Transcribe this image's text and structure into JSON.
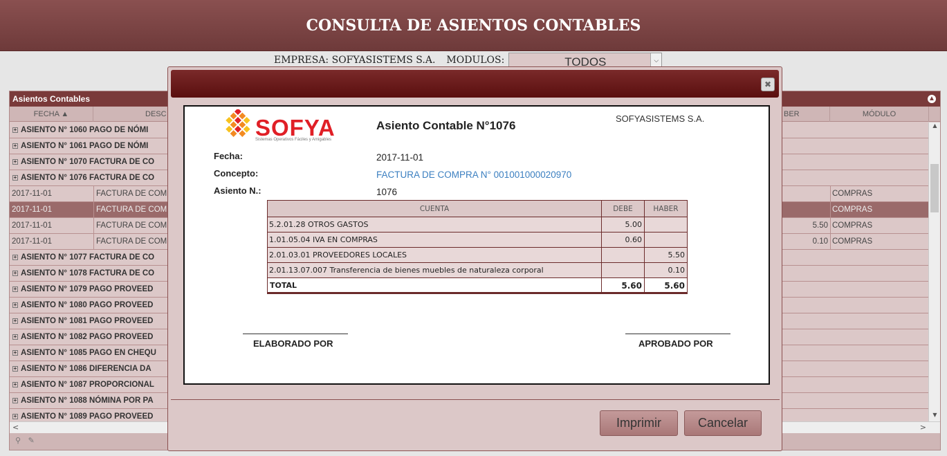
{
  "banner": {
    "title": "CONSULTA DE ASIENTOS CONTABLES"
  },
  "filter": {
    "empresa_label": "EMPRESA: SOFYASISTEMS S.A.",
    "modulos_label": "MODULOS:",
    "modulos_value": "TODOS"
  },
  "grid": {
    "title": "Asientos Contables",
    "headers": {
      "fecha": "FECHA",
      "desc": "DESC",
      "haber": "BER",
      "modulo": "MÓDULO"
    },
    "groups_top": [
      "ASIENTO N° 1060 PAGO DE NÓMI",
      "ASIENTO N° 1061 PAGO DE NÓMI",
      "ASIENTO N° 1070 FACTURA DE CO",
      "ASIENTO N° 1076 FACTURA DE CO"
    ],
    "details": [
      {
        "fecha": "2017-11-01",
        "desc": "FACTURA DE COM",
        "haber": "",
        "modulo": "COMPRAS"
      },
      {
        "fecha": "2017-11-01",
        "desc": "FACTURA DE COM",
        "haber": "",
        "modulo": "COMPRAS"
      },
      {
        "fecha": "2017-11-01",
        "desc": "FACTURA DE COM",
        "haber": "5.50",
        "modulo": "COMPRAS"
      },
      {
        "fecha": "2017-11-01",
        "desc": "FACTURA DE COM",
        "haber": "0.10",
        "modulo": "COMPRAS"
      }
    ],
    "groups_bottom": [
      "ASIENTO N° 1077 FACTURA DE CO",
      "ASIENTO N° 1078 FACTURA DE CO",
      "ASIENTO N° 1079 PAGO PROVEED",
      "ASIENTO N° 1080 PAGO PROVEED",
      "ASIENTO N° 1081 PAGO PROVEED",
      "ASIENTO N° 1082 PAGO PROVEED",
      "ASIENTO N° 1085 PAGO EN CHEQU",
      "ASIENTO N° 1086 DIFERENCIA DA",
      "ASIENTO N° 1087 PROPORCIONAL",
      "ASIENTO N° 1088 NÓMINA POR PA",
      "ASIENTO N° 1089 PAGO PROVEED"
    ]
  },
  "modal": {
    "logo": {
      "word": "SOFYA",
      "tagline": "Sistemas Operativos Fáciles y Amigables"
    },
    "doc_title": "Asiento Contable N°1076",
    "company": "SOFYASISTEMS S.A.",
    "fields": {
      "fecha_label": "Fecha:",
      "fecha_value": "2017-11-01",
      "concepto_label": "Concepto:",
      "concepto_value": "FACTURA DE COMPRA N° 001001000020970",
      "asiento_label": "Asiento N.:",
      "asiento_value": "1076"
    },
    "table": {
      "headers": {
        "cuenta": "CUENTA",
        "debe": "DEBE",
        "haber": "HABER"
      },
      "rows": [
        {
          "cuenta": "5.2.01.28 OTROS GASTOS",
          "debe": "5.00",
          "haber": ""
        },
        {
          "cuenta": "1.01.05.04 IVA EN COMPRAS",
          "debe": "0.60",
          "haber": ""
        },
        {
          "cuenta": "2.01.03.01 PROVEEDORES LOCALES",
          "debe": "",
          "haber": "5.50"
        },
        {
          "cuenta": "2.01.13.07.007 Transferencia de bienes muebles de naturaleza corporal",
          "debe": "",
          "haber": "0.10"
        }
      ],
      "total": {
        "label": "TOTAL",
        "debe": "5.60",
        "haber": "5.60"
      }
    },
    "signatures": {
      "elaborado": "ELABORADO POR",
      "aprobado": "APROBADO POR"
    },
    "buttons": {
      "print": "Imprimir",
      "cancel": "Cancelar"
    }
  }
}
